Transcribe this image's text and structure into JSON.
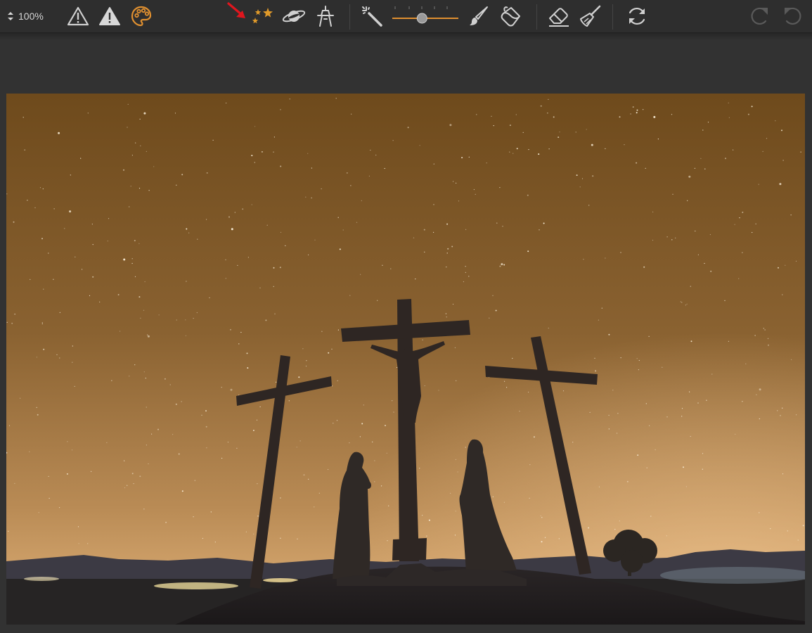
{
  "toolbar": {
    "zoom_value": "100%",
    "tools": [
      {
        "name": "zoom-stepper",
        "icon": "up-down-arrows-icon"
      },
      {
        "name": "clipping-warning-outline",
        "icon": "warning-triangle-outline-icon"
      },
      {
        "name": "clipping-warning-filled",
        "icon": "warning-triangle-filled-icon"
      },
      {
        "name": "color-palette",
        "icon": "palette-icon"
      },
      {
        "name": "stars-tool",
        "icon": "stars-icon"
      },
      {
        "name": "planet-tool",
        "icon": "planet-icon"
      },
      {
        "name": "landscape-tool",
        "icon": "tower-icon"
      },
      {
        "name": "magic-wand-tool",
        "icon": "magic-wand-icon"
      },
      {
        "name": "brush-tool",
        "icon": "brush-icon"
      },
      {
        "name": "fill-tool",
        "icon": "paint-bucket-icon"
      },
      {
        "name": "eraser-tool",
        "icon": "eraser-icon"
      },
      {
        "name": "clear-tool",
        "icon": "broom-icon"
      },
      {
        "name": "refresh-tool",
        "icon": "refresh-icon"
      },
      {
        "name": "redo-button",
        "icon": "redo-icon"
      },
      {
        "name": "undo-button",
        "icon": "undo-icon"
      }
    ],
    "tolerance_slider_value": 0.45
  },
  "colors": {
    "toolbar_bg": "#2e2e2e",
    "icon": "#d0d0d0",
    "accent_orange": "#e09030",
    "annotation_arrow": "#e0161e",
    "disabled_icon": "#5a5a5a",
    "sky_top": "#6e4a1c",
    "sky_horizon": "#e2b37a"
  },
  "canvas": {
    "image": "night-sky-photo-with-three-crosses"
  }
}
